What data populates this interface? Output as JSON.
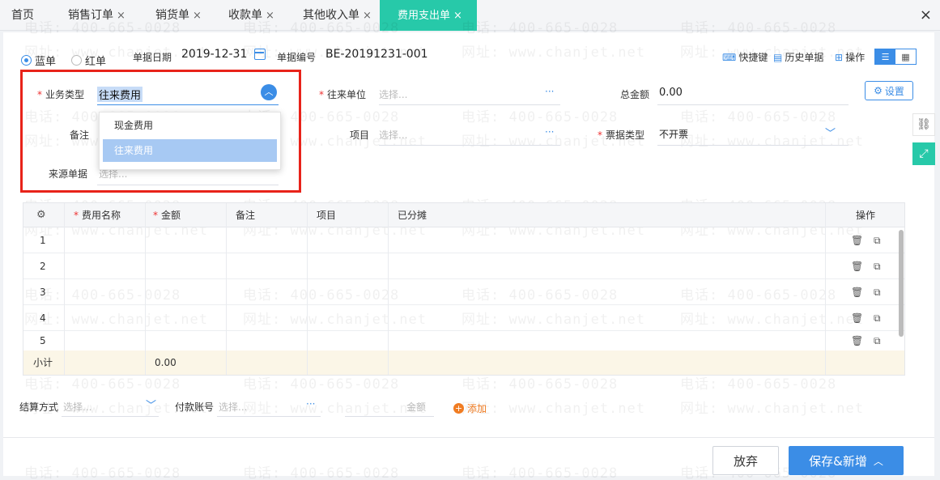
{
  "tabs": [
    {
      "label": "首页",
      "closable": false
    },
    {
      "label": "销售订单",
      "closable": true
    },
    {
      "label": "销货单",
      "closable": true
    },
    {
      "label": "收款单",
      "closable": true
    },
    {
      "label": "其他收入单",
      "closable": true
    },
    {
      "label": "费用支出单",
      "closable": true,
      "active": true
    }
  ],
  "close_symbol": "×",
  "header": {
    "blue_label": "蓝单",
    "red_label": "红单",
    "date_label": "单据日期",
    "date_value": "2019-12-31",
    "number_label": "单据编号",
    "number_value": "BE-20191231-001"
  },
  "toolbar": {
    "shortcut": "快捷键",
    "history": "历史单据",
    "operate": "操作",
    "settings": "设置"
  },
  "form": {
    "business_type_label": "业务类型",
    "business_type_value": "往来费用",
    "partner_label": "往来单位",
    "partner_placeholder": "选择...",
    "total_label": "总金额",
    "total_value": "0.00",
    "remark_label": "备注",
    "project_label": "项目",
    "project_placeholder": "选择...",
    "invoice_label": "票据类型",
    "invoice_value": "不开票",
    "source_label": "来源单据",
    "source_placeholder": "选择...",
    "ellipsis": "···"
  },
  "dropdown": {
    "options": [
      "现金费用",
      "往来费用"
    ],
    "selected_index": 1
  },
  "grid": {
    "columns": [
      "费用名称",
      "金额",
      "备注",
      "项目",
      "已分摊",
      "操作"
    ],
    "rows": [
      "1",
      "2",
      "3",
      "4",
      "5"
    ],
    "subtotal_label": "小计",
    "subtotal_amount": "0.00"
  },
  "payment": {
    "method_label": "结算方式",
    "method_placeholder": "选择...",
    "account_label": "付款账号",
    "account_placeholder": "选择...",
    "amount_placeholder": "金额",
    "add_label": "添加"
  },
  "footer": {
    "cancel_label": "放弃",
    "save_label": "保存&新增"
  },
  "watermark": {
    "phone": "电话: 400-665-0028",
    "site": "网址: www.chanjet.net"
  },
  "colors": {
    "accent": "#3b8de6",
    "active_tab": "#27c9a9",
    "highlight_box": "#e8231a",
    "required": "#ee3333"
  }
}
